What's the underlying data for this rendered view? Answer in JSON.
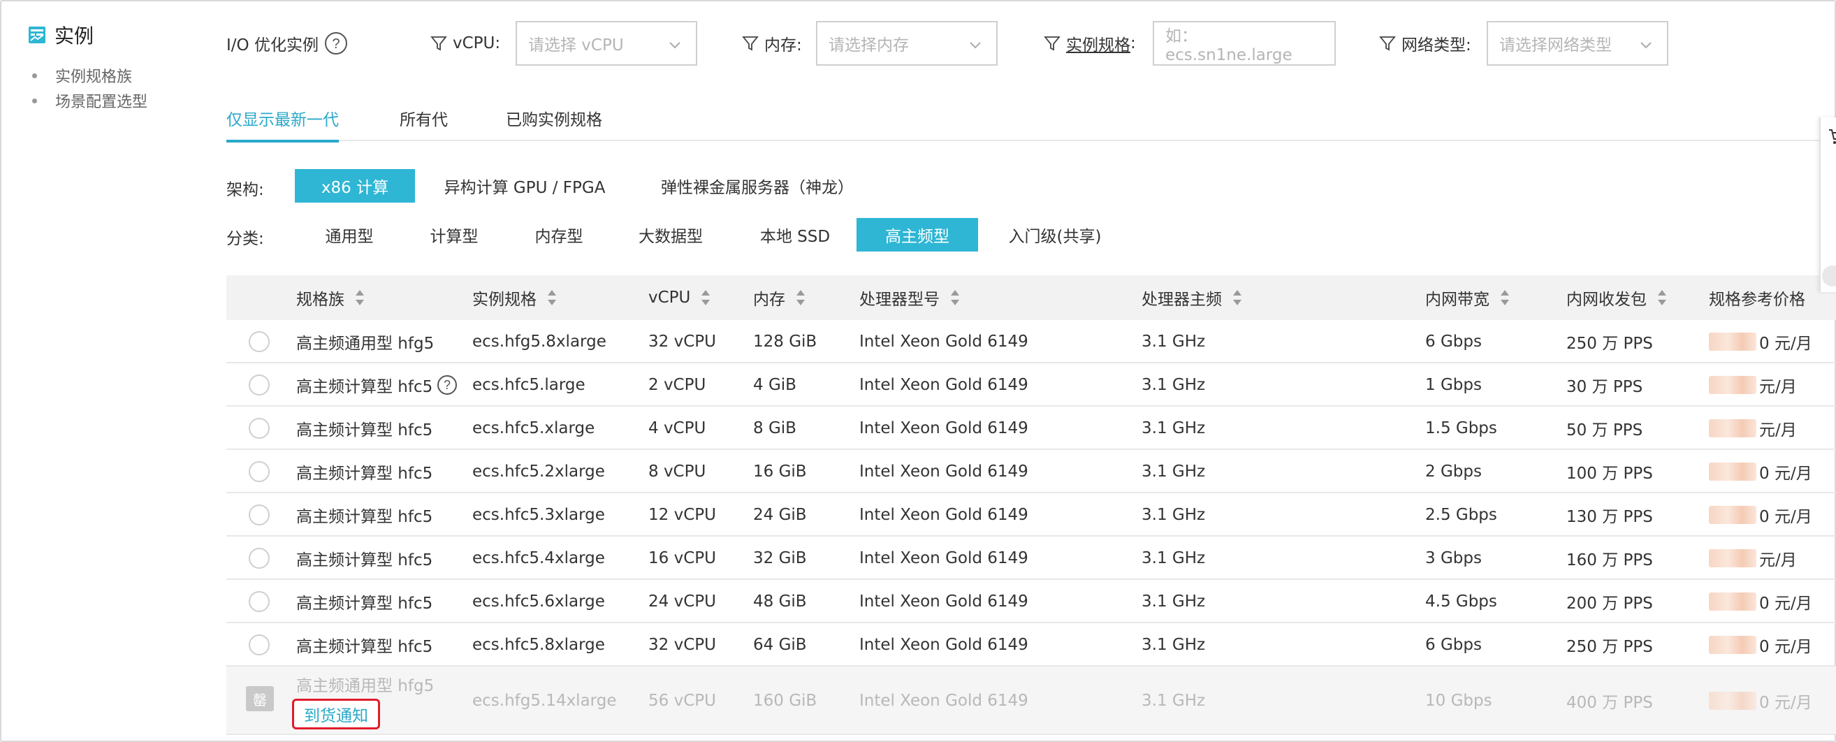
{
  "sidebar": {
    "title": "实例",
    "items": [
      {
        "label": "实例规格族"
      },
      {
        "label": "场景配置选型"
      }
    ]
  },
  "filters": {
    "io_label": "I/O 优化实例",
    "vcpu_label": "vCPU:",
    "vcpu_placeholder": "请选择 vCPU",
    "memory_label": "内存:",
    "memory_placeholder": "请选择内存",
    "spec_label": "实例规格",
    "spec_colon": ":",
    "spec_placeholder": "如：ecs.sn1ne.large",
    "network_label": "网络类型:",
    "network_placeholder": "请选择网络类型"
  },
  "tabs": [
    {
      "label": "仅显示最新一代",
      "active": true
    },
    {
      "label": "所有代",
      "active": false
    },
    {
      "label": "已购实例规格",
      "active": false
    }
  ],
  "architecture": {
    "label": "架构:",
    "options": [
      {
        "label": "x86 计算",
        "active": true
      },
      {
        "label": "异构计算 GPU / FPGA",
        "active": false
      },
      {
        "label": "弹性裸金属服务器（神龙）",
        "active": false
      }
    ]
  },
  "category": {
    "label": "分类:",
    "options": [
      {
        "label": "通用型",
        "active": false
      },
      {
        "label": "计算型",
        "active": false
      },
      {
        "label": "内存型",
        "active": false
      },
      {
        "label": "大数据型",
        "active": false
      },
      {
        "label": "本地 SSD",
        "active": false
      },
      {
        "label": "高主频型",
        "active": true
      },
      {
        "label": "入门级(共享)",
        "active": false
      }
    ]
  },
  "table": {
    "columns": [
      "规格族",
      "实例规格",
      "vCPU",
      "内存",
      "处理器型号",
      "处理器主频",
      "内网带宽",
      "内网收发包",
      "规格参考价格"
    ],
    "rows": [
      {
        "family": "高主频通用型 hfg5",
        "spec": "ecs.hfg5.8xlarge",
        "vcpu": "32 vCPU",
        "memory": "128 GiB",
        "cpu": "Intel Xeon Gold 6149",
        "freq": "3.1 GHz",
        "bandwidth": "6 Gbps",
        "pps": "250 万 PPS",
        "price_tail": "0 元/月"
      },
      {
        "family": "高主频计算型 hfc5",
        "spec": "ecs.hfc5.large",
        "vcpu": "2 vCPU",
        "memory": "4 GiB",
        "cpu": "Intel Xeon Gold 6149",
        "freq": "3.1 GHz",
        "bandwidth": "1 Gbps",
        "pps": "30 万 PPS",
        "price_tail": "元/月"
      },
      {
        "family": "高主频计算型 hfc5",
        "spec": "ecs.hfc5.xlarge",
        "vcpu": "4 vCPU",
        "memory": "8 GiB",
        "cpu": "Intel Xeon Gold 6149",
        "freq": "3.1 GHz",
        "bandwidth": "1.5 Gbps",
        "pps": "50 万 PPS",
        "price_tail": "元/月"
      },
      {
        "family": "高主频计算型 hfc5",
        "spec": "ecs.hfc5.2xlarge",
        "vcpu": "8 vCPU",
        "memory": "16 GiB",
        "cpu": "Intel Xeon Gold 6149",
        "freq": "3.1 GHz",
        "bandwidth": "2 Gbps",
        "pps": "100 万 PPS",
        "price_tail": "0 元/月"
      },
      {
        "family": "高主频计算型 hfc5",
        "spec": "ecs.hfc5.3xlarge",
        "vcpu": "12 vCPU",
        "memory": "24 GiB",
        "cpu": "Intel Xeon Gold 6149",
        "freq": "3.1 GHz",
        "bandwidth": "2.5 Gbps",
        "pps": "130 万 PPS",
        "price_tail": "0 元/月"
      },
      {
        "family": "高主频计算型 hfc5",
        "spec": "ecs.hfc5.4xlarge",
        "vcpu": "16 vCPU",
        "memory": "32 GiB",
        "cpu": "Intel Xeon Gold 6149",
        "freq": "3.1 GHz",
        "bandwidth": "3 Gbps",
        "pps": "160 万 PPS",
        "price_tail": "元/月"
      },
      {
        "family": "高主频计算型 hfc5",
        "spec": "ecs.hfc5.6xlarge",
        "vcpu": "24 vCPU",
        "memory": "48 GiB",
        "cpu": "Intel Xeon Gold 6149",
        "freq": "3.1 GHz",
        "bandwidth": "4.5 Gbps",
        "pps": "200 万 PPS",
        "price_tail": "0 元/月"
      },
      {
        "family": "高主频计算型 hfc5",
        "spec": "ecs.hfc5.8xlarge",
        "vcpu": "32 vCPU",
        "memory": "64 GiB",
        "cpu": "Intel Xeon Gold 6149",
        "freq": "3.1 GHz",
        "bandwidth": "6 Gbps",
        "pps": "250 万 PPS",
        "price_tail": "0 元/月"
      }
    ],
    "soldout_row": {
      "tag": "罄",
      "family": "高主频通用型 hfg5",
      "notify": "到货通知",
      "spec": "ecs.hfg5.14xlarge",
      "vcpu": "56 vCPU",
      "memory": "160 GiB",
      "cpu": "Intel Xeon Gold 6149",
      "freq": "3.1 GHz",
      "bandwidth": "10 Gbps",
      "pps": "400 万 PPS",
      "price_tail": "0 元/月"
    }
  },
  "colors": {
    "accent": "#2eb6d4",
    "highlight_border": "#e01c2c"
  }
}
